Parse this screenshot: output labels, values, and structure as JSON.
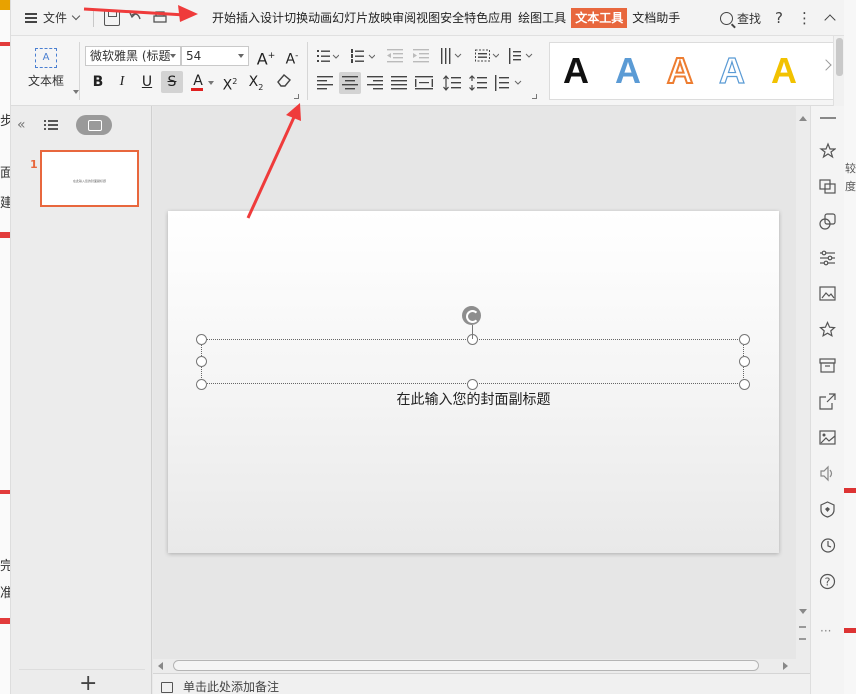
{
  "menubar": {
    "file_label": "文件",
    "tabs": [
      "开始",
      "插入",
      "设计",
      "切换",
      "动画",
      "幻灯片放映",
      "审阅",
      "视图",
      "安全",
      "特色应用",
      "绘图工具",
      "文本工具",
      "文档助手"
    ],
    "active_tab": "文本工具",
    "find_label": "查找",
    "help_glyph": "?",
    "more_glyph": "⋮"
  },
  "ribbon": {
    "textbox_label": "文本框",
    "font_name": "微软雅黑 (标题",
    "font_size": "54",
    "grow_font": "A",
    "shrink_font": "A",
    "bold": "B",
    "italic": "I",
    "underline": "U",
    "strike": "S",
    "font_color": "A",
    "superscript": "X",
    "subscript": "X",
    "sup_mark": "2",
    "sub_mark": "2",
    "style_letters": [
      "A",
      "A",
      "A",
      "A",
      "A"
    ],
    "colors": {
      "accent": "#e8673d",
      "style_black": "#111111",
      "style_blue": "#5b9bd5",
      "style_orange": "#ed7d31",
      "style_gold": "#f2c200",
      "font_color_bar": "#e02020"
    }
  },
  "sidebar": {
    "slide_number": "1",
    "thumb_text": "在此输入您的封面副标题",
    "add_glyph": "+"
  },
  "slide": {
    "subtitle": "在此输入您的封面副标题"
  },
  "notes": {
    "placeholder": "单击此处添加备注"
  },
  "background_window_fragments": {
    "left": [
      "步",
      "面",
      "建",
      "完",
      "准"
    ],
    "right": [
      "较",
      "度"
    ]
  }
}
